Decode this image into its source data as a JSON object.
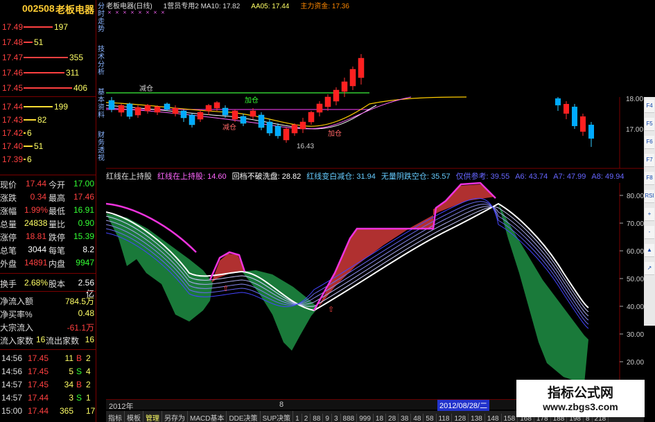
{
  "stock": {
    "code": "002508",
    "name": "老板电器"
  },
  "order_book": {
    "sells": [
      {
        "price": "17.49",
        "volume": "197",
        "bar": 60
      },
      {
        "price": "17.48",
        "volume": "51",
        "bar": 18
      },
      {
        "price": "17.47",
        "volume": "355",
        "bar": 92
      },
      {
        "price": "17.46",
        "volume": "311",
        "bar": 84
      },
      {
        "price": "17.45",
        "volume": "406",
        "bar": 100
      }
    ],
    "buys": [
      {
        "price": "17.44",
        "volume": "199",
        "bar": 60
      },
      {
        "price": "17.43",
        "volume": "82",
        "bar": 26
      },
      {
        "price": "17.42",
        "volume": "6",
        "bar": 4
      },
      {
        "price": "17.40",
        "volume": "51",
        "bar": 18
      },
      {
        "price": "17.39",
        "volume": "6",
        "bar": 4
      }
    ]
  },
  "quote": [
    {
      "l1": "现价",
      "v1": "17.44",
      "l2": "今开",
      "v2": "17.00"
    },
    {
      "l1": "涨跌",
      "v1": "0.34",
      "l2": "最高",
      "v2": "17.46"
    },
    {
      "l1": "涨幅",
      "v1": "1.99%",
      "l2": "最低",
      "v2": "16.91"
    },
    {
      "l1": "总量",
      "v1": "24838",
      "l2": "量比",
      "v2": "0.90"
    },
    {
      "l1": "涨停",
      "v1": "18.81",
      "l2": "跌停",
      "v2": "15.39"
    },
    {
      "l1": "总笔",
      "v1": "3044",
      "l2": "每笔",
      "v2": "8.2"
    },
    {
      "l1": "外盘",
      "v1": "14891",
      "l2": "内盘",
      "v2": "9947"
    }
  ],
  "turnover": {
    "l1": "换手",
    "v1": "2.68%",
    "l2": "股本",
    "v2": "2.56亿"
  },
  "flow": [
    {
      "label": "净流入额",
      "value": "784.5万"
    },
    {
      "label": "净买率%",
      "value": "0.48"
    },
    {
      "label": "大宗流入",
      "value": "-61.1万"
    }
  ],
  "flow_count": {
    "l1": "流入家数",
    "v1": "16",
    "l2": "流出家数",
    "v2": "16"
  },
  "ticks": [
    {
      "time": "14:56",
      "price": "17.45",
      "vol": "11",
      "side": "B",
      "n": "2"
    },
    {
      "time": "14:56",
      "price": "17.45",
      "vol": "5",
      "side": "S",
      "n": "4"
    },
    {
      "time": "14:57",
      "price": "17.45",
      "vol": "34",
      "side": "B",
      "n": "2"
    },
    {
      "time": "14:57",
      "price": "17.44",
      "vol": "3",
      "side": "S",
      "n": "1"
    },
    {
      "time": "15:00",
      "price": "17.44",
      "vol": "365",
      "side": "",
      "n": "17"
    }
  ],
  "side_tabs": [
    "分时走势",
    "技术分析",
    "基本资料",
    "财务透视"
  ],
  "top_header": [
    {
      "text": "老板电器(日线)",
      "color": "#dddddd"
    },
    {
      "text": "1营员专用2 MA10: 17.82",
      "color": "#dddddd"
    },
    {
      "text": "AA05: 17.44",
      "color": "#ffff66"
    },
    {
      "text": "主力资金: 17.36",
      "color": "#ff8800"
    }
  ],
  "top_annotations": {
    "jianchang_1": "减仓",
    "jianchang_2": "减仓",
    "jiacang": "加仓",
    "jiacang_2": "加仓",
    "low": "16.43"
  },
  "top_axis": [
    "18.00",
    "17.00"
  ],
  "bot_header": [
    {
      "text": "红线在上持股",
      "color": "#dddddd"
    },
    {
      "text": "红线在上持股: 14.60",
      "color": "#ff66ff"
    },
    {
      "text": "回档不破洗盘: 28.82",
      "color": "#ffffff"
    },
    {
      "text": "红线变白减仓: 31.94",
      "color": "#66ccff"
    },
    {
      "text": "无量阴跌空仓: 35.57",
      "color": "#66ccff"
    },
    {
      "text": "仅供参考: 39.55",
      "color": "#6666ff"
    },
    {
      "text": "A6: 43.74",
      "color": "#6666ff"
    },
    {
      "text": "A7: 47.99",
      "color": "#6666ff"
    },
    {
      "text": "A8: 49.94",
      "color": "#6666ff"
    }
  ],
  "bot_axis": [
    "80.00",
    "70.00",
    "60.00",
    "50.00",
    "40.00",
    "30.00",
    "20.00"
  ],
  "date_bar": {
    "year": "2012年",
    "mid": "8",
    "selected": "2012/08/28/二"
  },
  "bottom_tabs": [
    "指标",
    "模板",
    "管理",
    "另存为",
    "MACD基本",
    "DDE决策",
    "SUP决策",
    "1",
    "2",
    "88",
    "9",
    "3",
    "888",
    "999",
    "18",
    "28",
    "38",
    "48",
    "58",
    "118",
    "128",
    "138",
    "148",
    "158",
    "168",
    "178",
    "188",
    "198",
    "8",
    "218"
  ],
  "right_toolbar": [
    "F4",
    "F5",
    "F6",
    "F7",
    "F8",
    "RSI",
    "+",
    "-",
    "▲",
    "↗"
  ],
  "watermark": {
    "title": "指标公式网",
    "url": "www.zbgs3.com"
  },
  "colors": {
    "up": "#ff4040",
    "down": "#33ff33",
    "accent": "#ffff66",
    "panel_border": "#7a0000"
  }
}
